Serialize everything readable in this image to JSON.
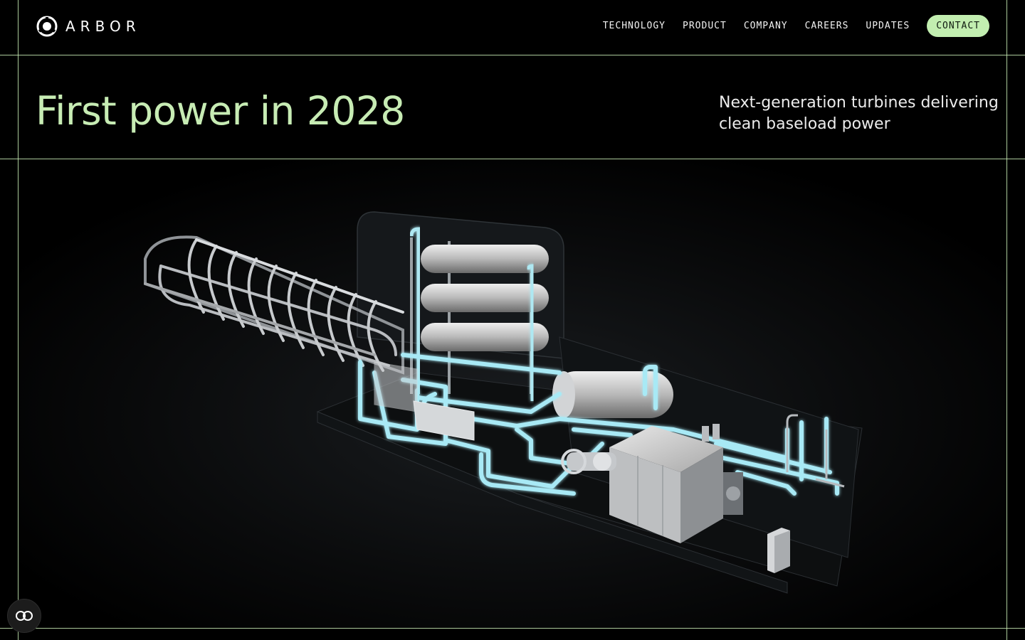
{
  "brand": {
    "name": "ARBOR",
    "logo_icon": "arbor-logo-icon"
  },
  "nav": {
    "items": [
      {
        "label": "TECHNOLOGY"
      },
      {
        "label": "PRODUCT"
      },
      {
        "label": "COMPANY"
      },
      {
        "label": "CAREERS"
      },
      {
        "label": "UPDATES"
      }
    ],
    "contact_label": "CONTACT"
  },
  "hero": {
    "title": "First power in 2028",
    "subtitle": "Next-generation turbines delivering clean baseload power"
  },
  "illustration": {
    "subject": "turbine-plant-render"
  },
  "accessibility_button": {
    "icon": "accessibility-toggle-icon"
  },
  "colors": {
    "background": "#000000",
    "accent": "#c2eeb0",
    "title": "#c7ecb4",
    "grid_line": "#c9ecb5",
    "glow": "#9fe6f2"
  }
}
